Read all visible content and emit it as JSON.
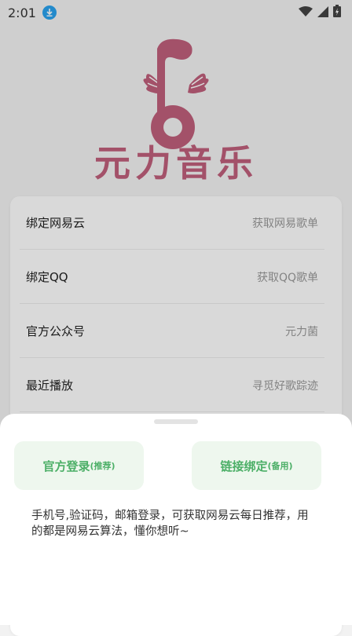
{
  "status": {
    "time": "2:01"
  },
  "brand": {
    "name": "元力音乐",
    "color": "#c0607c"
  },
  "menu": [
    {
      "label": "绑定网易云",
      "hint": "获取网易歌单"
    },
    {
      "label": "绑定QQ",
      "hint": "获取QQ歌单"
    },
    {
      "label": "官方公众号",
      "hint": "元力菌"
    },
    {
      "label": "最近播放",
      "hint": "寻觅好歌踪迹"
    }
  ],
  "sheet": {
    "login_label": "官方登录",
    "login_tag": "(推荐)",
    "link_label": "链接绑定",
    "link_tag": "(备用)",
    "description": "手机号,验证码，邮箱登录，可获取网易云每日推荐，用的都是网易云算法，懂你想听~"
  },
  "colors": {
    "accent_green": "#4caf67",
    "button_bg": "#eef7ee"
  }
}
